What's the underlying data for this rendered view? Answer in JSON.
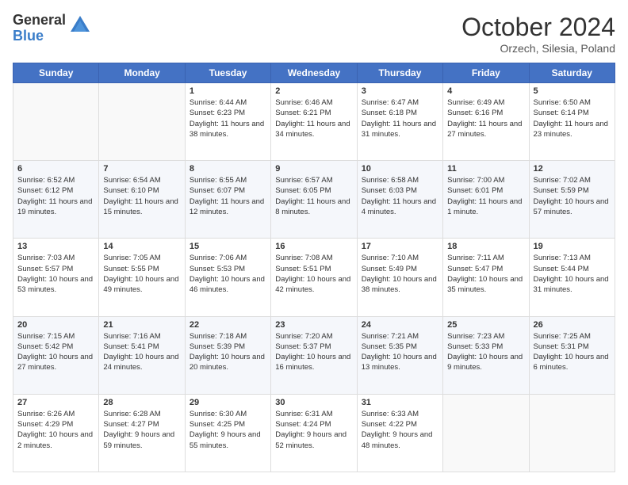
{
  "logo": {
    "general": "General",
    "blue": "Blue"
  },
  "header": {
    "month": "October 2024",
    "location": "Orzech, Silesia, Poland"
  },
  "weekdays": [
    "Sunday",
    "Monday",
    "Tuesday",
    "Wednesday",
    "Thursday",
    "Friday",
    "Saturday"
  ],
  "weeks": [
    [
      {
        "day": "",
        "sunrise": "",
        "sunset": "",
        "daylight": ""
      },
      {
        "day": "",
        "sunrise": "",
        "sunset": "",
        "daylight": ""
      },
      {
        "day": "1",
        "sunrise": "Sunrise: 6:44 AM",
        "sunset": "Sunset: 6:23 PM",
        "daylight": "Daylight: 11 hours and 38 minutes."
      },
      {
        "day": "2",
        "sunrise": "Sunrise: 6:46 AM",
        "sunset": "Sunset: 6:21 PM",
        "daylight": "Daylight: 11 hours and 34 minutes."
      },
      {
        "day": "3",
        "sunrise": "Sunrise: 6:47 AM",
        "sunset": "Sunset: 6:18 PM",
        "daylight": "Daylight: 11 hours and 31 minutes."
      },
      {
        "day": "4",
        "sunrise": "Sunrise: 6:49 AM",
        "sunset": "Sunset: 6:16 PM",
        "daylight": "Daylight: 11 hours and 27 minutes."
      },
      {
        "day": "5",
        "sunrise": "Sunrise: 6:50 AM",
        "sunset": "Sunset: 6:14 PM",
        "daylight": "Daylight: 11 hours and 23 minutes."
      }
    ],
    [
      {
        "day": "6",
        "sunrise": "Sunrise: 6:52 AM",
        "sunset": "Sunset: 6:12 PM",
        "daylight": "Daylight: 11 hours and 19 minutes."
      },
      {
        "day": "7",
        "sunrise": "Sunrise: 6:54 AM",
        "sunset": "Sunset: 6:10 PM",
        "daylight": "Daylight: 11 hours and 15 minutes."
      },
      {
        "day": "8",
        "sunrise": "Sunrise: 6:55 AM",
        "sunset": "Sunset: 6:07 PM",
        "daylight": "Daylight: 11 hours and 12 minutes."
      },
      {
        "day": "9",
        "sunrise": "Sunrise: 6:57 AM",
        "sunset": "Sunset: 6:05 PM",
        "daylight": "Daylight: 11 hours and 8 minutes."
      },
      {
        "day": "10",
        "sunrise": "Sunrise: 6:58 AM",
        "sunset": "Sunset: 6:03 PM",
        "daylight": "Daylight: 11 hours and 4 minutes."
      },
      {
        "day": "11",
        "sunrise": "Sunrise: 7:00 AM",
        "sunset": "Sunset: 6:01 PM",
        "daylight": "Daylight: 11 hours and 1 minute."
      },
      {
        "day": "12",
        "sunrise": "Sunrise: 7:02 AM",
        "sunset": "Sunset: 5:59 PM",
        "daylight": "Daylight: 10 hours and 57 minutes."
      }
    ],
    [
      {
        "day": "13",
        "sunrise": "Sunrise: 7:03 AM",
        "sunset": "Sunset: 5:57 PM",
        "daylight": "Daylight: 10 hours and 53 minutes."
      },
      {
        "day": "14",
        "sunrise": "Sunrise: 7:05 AM",
        "sunset": "Sunset: 5:55 PM",
        "daylight": "Daylight: 10 hours and 49 minutes."
      },
      {
        "day": "15",
        "sunrise": "Sunrise: 7:06 AM",
        "sunset": "Sunset: 5:53 PM",
        "daylight": "Daylight: 10 hours and 46 minutes."
      },
      {
        "day": "16",
        "sunrise": "Sunrise: 7:08 AM",
        "sunset": "Sunset: 5:51 PM",
        "daylight": "Daylight: 10 hours and 42 minutes."
      },
      {
        "day": "17",
        "sunrise": "Sunrise: 7:10 AM",
        "sunset": "Sunset: 5:49 PM",
        "daylight": "Daylight: 10 hours and 38 minutes."
      },
      {
        "day": "18",
        "sunrise": "Sunrise: 7:11 AM",
        "sunset": "Sunset: 5:47 PM",
        "daylight": "Daylight: 10 hours and 35 minutes."
      },
      {
        "day": "19",
        "sunrise": "Sunrise: 7:13 AM",
        "sunset": "Sunset: 5:44 PM",
        "daylight": "Daylight: 10 hours and 31 minutes."
      }
    ],
    [
      {
        "day": "20",
        "sunrise": "Sunrise: 7:15 AM",
        "sunset": "Sunset: 5:42 PM",
        "daylight": "Daylight: 10 hours and 27 minutes."
      },
      {
        "day": "21",
        "sunrise": "Sunrise: 7:16 AM",
        "sunset": "Sunset: 5:41 PM",
        "daylight": "Daylight: 10 hours and 24 minutes."
      },
      {
        "day": "22",
        "sunrise": "Sunrise: 7:18 AM",
        "sunset": "Sunset: 5:39 PM",
        "daylight": "Daylight: 10 hours and 20 minutes."
      },
      {
        "day": "23",
        "sunrise": "Sunrise: 7:20 AM",
        "sunset": "Sunset: 5:37 PM",
        "daylight": "Daylight: 10 hours and 16 minutes."
      },
      {
        "day": "24",
        "sunrise": "Sunrise: 7:21 AM",
        "sunset": "Sunset: 5:35 PM",
        "daylight": "Daylight: 10 hours and 13 minutes."
      },
      {
        "day": "25",
        "sunrise": "Sunrise: 7:23 AM",
        "sunset": "Sunset: 5:33 PM",
        "daylight": "Daylight: 10 hours and 9 minutes."
      },
      {
        "day": "26",
        "sunrise": "Sunrise: 7:25 AM",
        "sunset": "Sunset: 5:31 PM",
        "daylight": "Daylight: 10 hours and 6 minutes."
      }
    ],
    [
      {
        "day": "27",
        "sunrise": "Sunrise: 6:26 AM",
        "sunset": "Sunset: 4:29 PM",
        "daylight": "Daylight: 10 hours and 2 minutes."
      },
      {
        "day": "28",
        "sunrise": "Sunrise: 6:28 AM",
        "sunset": "Sunset: 4:27 PM",
        "daylight": "Daylight: 9 hours and 59 minutes."
      },
      {
        "day": "29",
        "sunrise": "Sunrise: 6:30 AM",
        "sunset": "Sunset: 4:25 PM",
        "daylight": "Daylight: 9 hours and 55 minutes."
      },
      {
        "day": "30",
        "sunrise": "Sunrise: 6:31 AM",
        "sunset": "Sunset: 4:24 PM",
        "daylight": "Daylight: 9 hours and 52 minutes."
      },
      {
        "day": "31",
        "sunrise": "Sunrise: 6:33 AM",
        "sunset": "Sunset: 4:22 PM",
        "daylight": "Daylight: 9 hours and 48 minutes."
      },
      {
        "day": "",
        "sunrise": "",
        "sunset": "",
        "daylight": ""
      },
      {
        "day": "",
        "sunrise": "",
        "sunset": "",
        "daylight": ""
      }
    ]
  ]
}
